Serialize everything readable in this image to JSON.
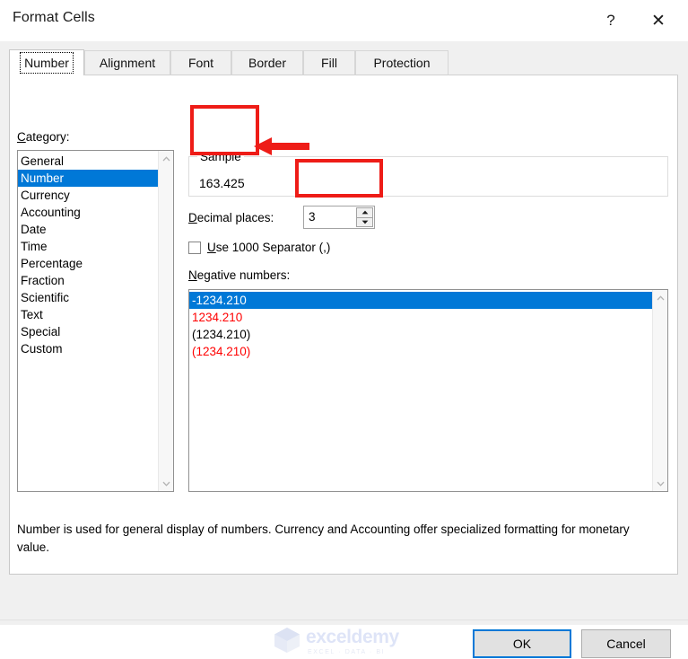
{
  "window": {
    "title": "Format Cells",
    "help_icon": "?",
    "close_icon": "✕"
  },
  "tabs": [
    {
      "label": "Alignment",
      "active": false
    },
    {
      "label": "Font",
      "active": false
    },
    {
      "label": "Border",
      "active": false
    },
    {
      "label": "Fill",
      "active": false
    },
    {
      "label": "Protection",
      "active": false
    }
  ],
  "active_tab": "Number",
  "category": {
    "label": "Category:",
    "accelerator": "C",
    "items": [
      "General",
      "Number",
      "Currency",
      "Accounting",
      "Date",
      "Time",
      "Percentage",
      "Fraction",
      "Scientific",
      "Text",
      "Special",
      "Custom"
    ],
    "selected": "Number"
  },
  "sample": {
    "caption": "Sample",
    "value": "163.425"
  },
  "decimal_places": {
    "label": "Decimal places:",
    "accelerator": "D",
    "value": "3",
    "spin_up_icon": "spinner-up-icon",
    "spin_down_icon": "spinner-down-icon"
  },
  "thousand_separator": {
    "label": "Use 1000 Separator (,)",
    "accelerator": "U",
    "checked": false
  },
  "negative_numbers": {
    "label": "Negative numbers:",
    "accelerator": "N",
    "items": [
      {
        "text": "-1234.210",
        "color": "#000000",
        "selected": true
      },
      {
        "text": "1234.210",
        "color": "#ff0000",
        "selected": false
      },
      {
        "text": "(1234.210)",
        "color": "#000000",
        "selected": false
      },
      {
        "text": "(1234.210)",
        "color": "#ff0000",
        "selected": false
      }
    ]
  },
  "description": "Number is used for general display of numbers.  Currency and Accounting offer specialized formatting for monetary value.",
  "buttons": {
    "ok": "OK",
    "cancel": "Cancel"
  },
  "watermark": {
    "name": "exceldemy",
    "tagline": "EXCEL · DATA · BI"
  },
  "colors": {
    "selection": "#0078d7",
    "annotation": "#ee1c17",
    "negative_red": "#ff0000",
    "dialog_bg": "#f0f0f0"
  },
  "annotations": [
    {
      "name": "sample-highlight",
      "shape": "rectangle",
      "color": "#ee1c17"
    },
    {
      "name": "decimal-places-highlight",
      "shape": "rectangle",
      "color": "#ee1c17"
    },
    {
      "name": "pointer-arrow",
      "shape": "arrow-left",
      "color": "#ee1c17"
    }
  ]
}
